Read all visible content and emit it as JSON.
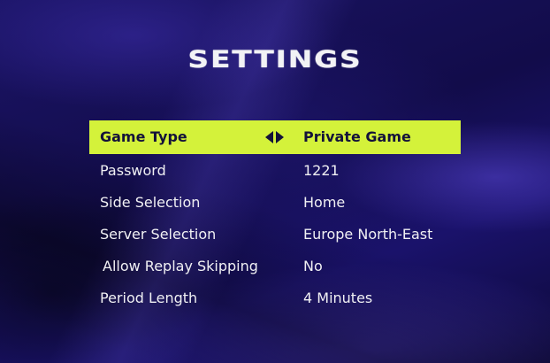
{
  "screen": {
    "title": "SETTINGS"
  },
  "settings": [
    {
      "label": "Game Type",
      "value": "Private Game",
      "selected": true
    },
    {
      "label": "Password",
      "value": "1221"
    },
    {
      "label": "Side Selection",
      "value": "Home"
    },
    {
      "label": "Server Selection",
      "value": "Europe North-East"
    },
    {
      "label": "Allow Replay Skipping",
      "value": "No"
    },
    {
      "label": "Period Length",
      "value": "4 Minutes"
    }
  ],
  "icons": {
    "selector": "left-right-arrows-icon"
  },
  "colors": {
    "highlight": "#d4f23a",
    "highlight_text": "#14123a",
    "text": "#f0f0f3",
    "background": "#140f52"
  }
}
